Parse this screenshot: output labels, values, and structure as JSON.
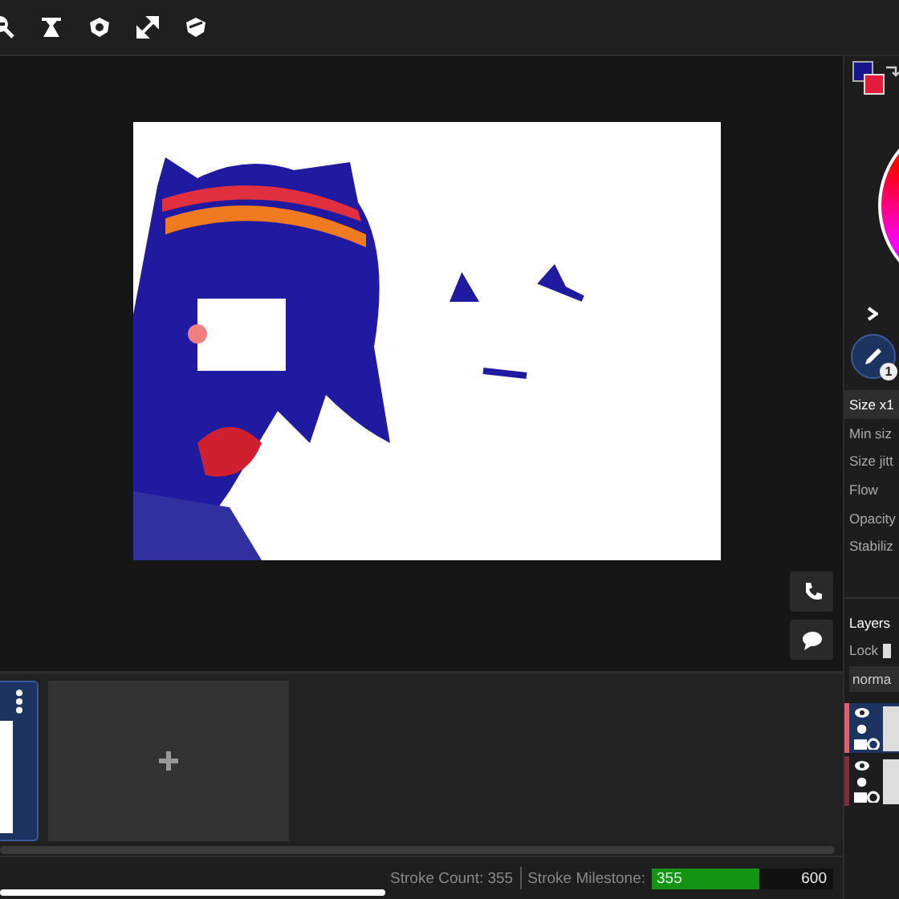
{
  "color_swatches": [
    {
      "color": "#16168a"
    },
    {
      "color": "#e21c3a"
    }
  ],
  "brush": {
    "badge": "1"
  },
  "brush_settings": [
    {
      "label": "Size x1",
      "selected": true
    },
    {
      "label": "Min siz",
      "selected": false
    },
    {
      "label": "Size jitt",
      "selected": false
    },
    {
      "label": "Flow",
      "selected": false
    },
    {
      "label": "Opacity",
      "selected": false
    },
    {
      "label": "Stabiliz",
      "selected": false
    }
  ],
  "layers": {
    "title": "Layers",
    "lock_label": "Lock",
    "blend_mode": "norma",
    "items": [
      {
        "selected": true,
        "visible": true
      },
      {
        "selected": false,
        "visible": true
      }
    ]
  },
  "frames": [
    {
      "selected": true
    }
  ],
  "status_bar": {
    "stroke_count": "Stroke Count: 355",
    "milestone_label": "Stroke Milestone:",
    "progress": {
      "value": "355",
      "target": "600",
      "level": 0.59
    }
  }
}
